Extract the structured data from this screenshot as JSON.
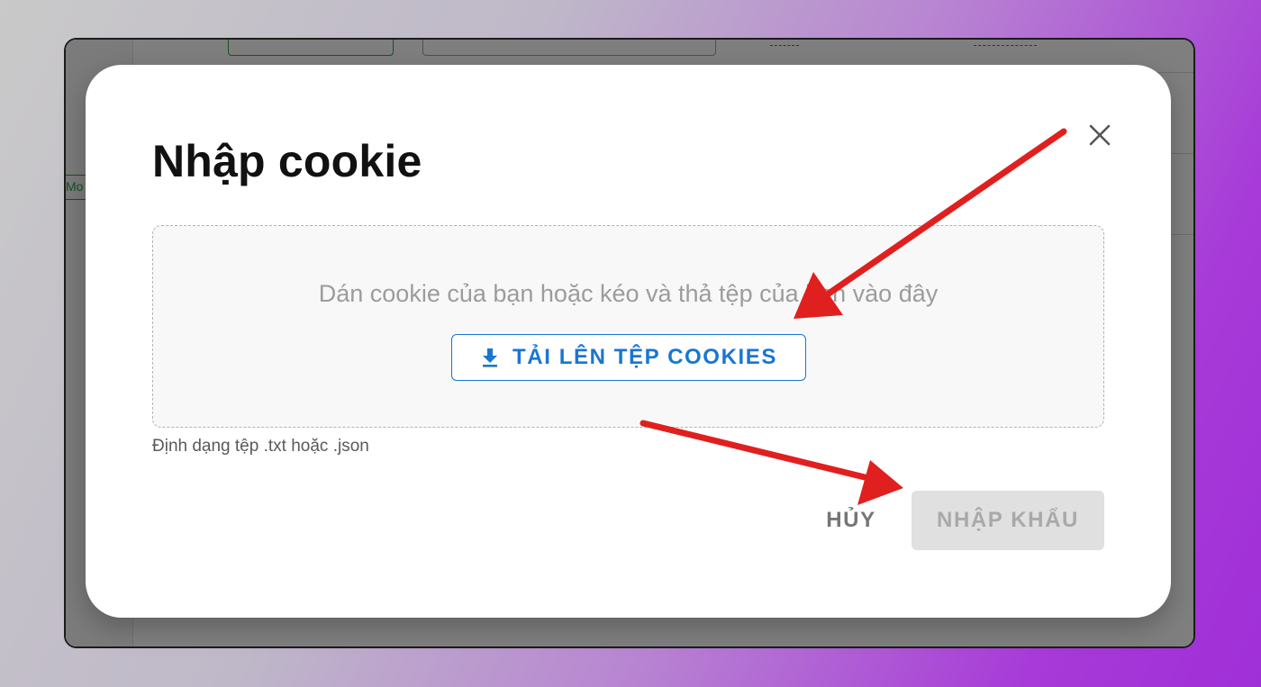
{
  "background_app": {
    "side_tag_label": "Mo"
  },
  "dialog": {
    "title": "Nhập cookie",
    "close_icon": "close-icon",
    "dropzone": {
      "instruction": "Dán cookie của bạn hoặc kéo và thả tệp của bạn vào đây",
      "upload_button_label": "TẢI LÊN TỆP COOKIES",
      "upload_icon": "download-icon"
    },
    "helper_text": "Định dạng tệp .txt hoặc .json",
    "actions": {
      "cancel_label": "HỦY",
      "import_label": "NHẬP KHẨU",
      "import_disabled": true
    }
  },
  "annotations": {
    "arrow_color": "#e0201e",
    "arrow_count": 2
  },
  "colors": {
    "primary": "#1976d2",
    "disabled_bg": "#e0e0e0",
    "disabled_text": "#a9a9a9",
    "accent_green": "#2e9c3e"
  }
}
